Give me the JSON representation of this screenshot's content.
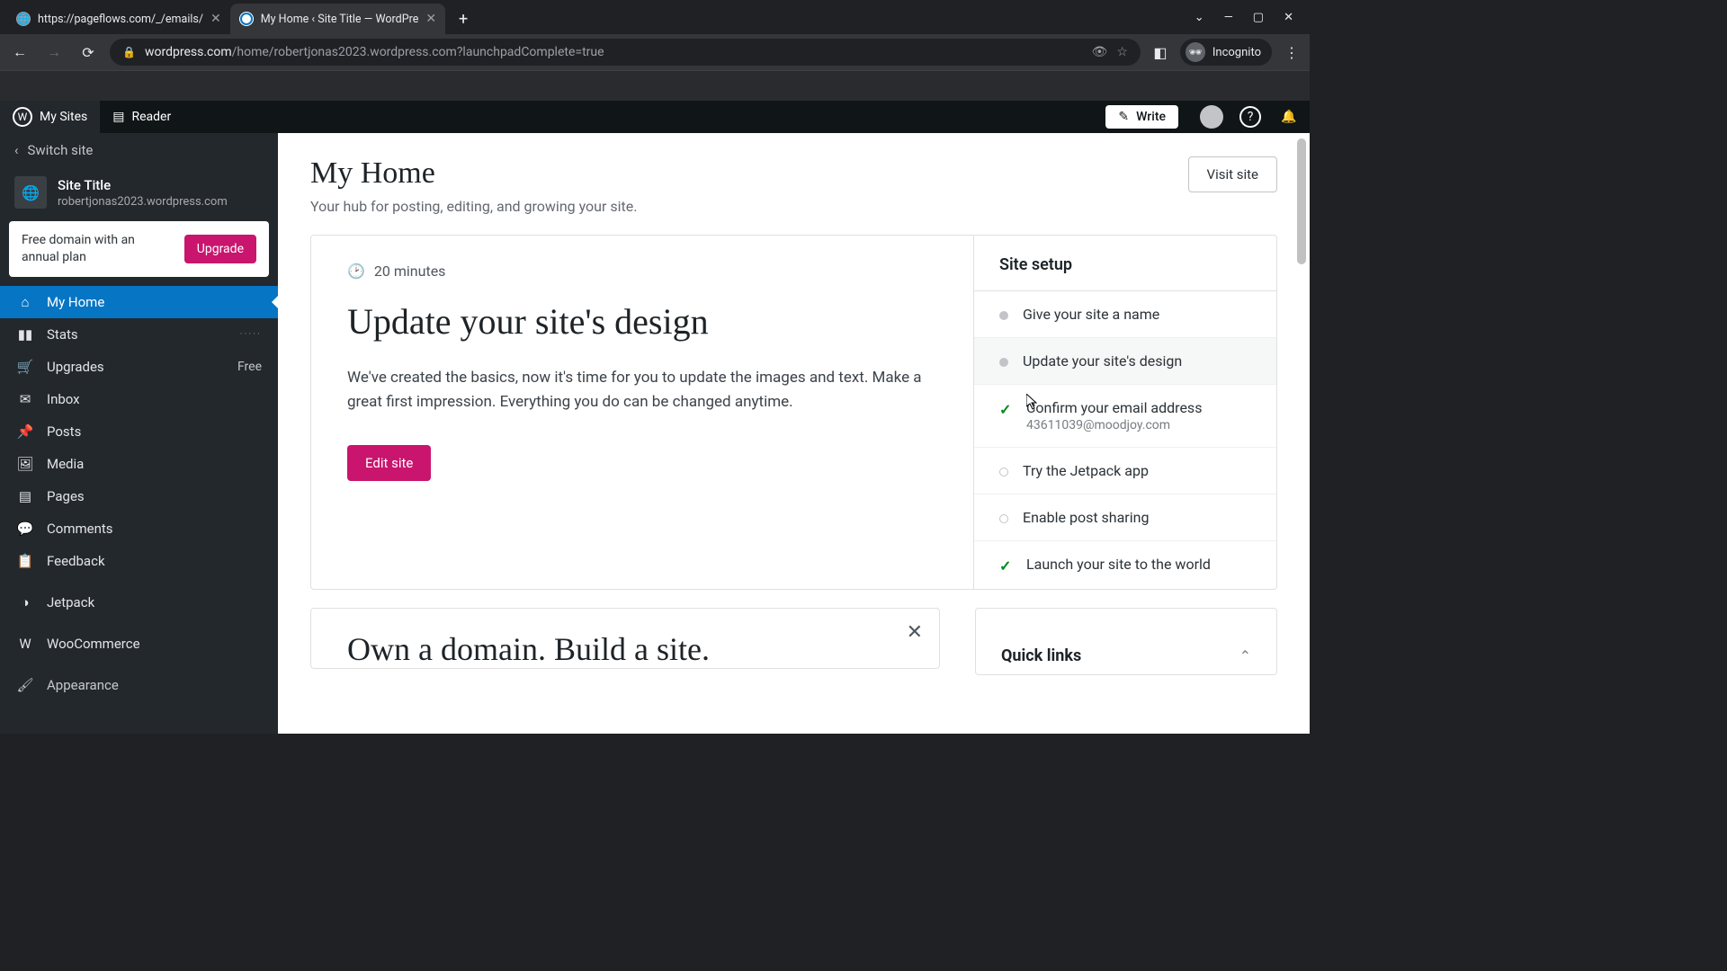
{
  "browser": {
    "tabs": [
      {
        "title": "https://pageflows.com/_/emails/",
        "active": false
      },
      {
        "title": "My Home ‹ Site Title — WordPre",
        "active": true
      }
    ],
    "url_host": "wordpress.com",
    "url_path": "/home/robertjonas2023.wordpress.com?launchpadComplete=true",
    "incognito_label": "Incognito"
  },
  "masterbar": {
    "my_sites": "My Sites",
    "reader": "Reader",
    "write": "Write"
  },
  "sidebar": {
    "switch": "Switch site",
    "site_title": "Site Title",
    "site_domain": "robertjonas2023.wordpress.com",
    "promo_text": "Free domain with an annual plan",
    "upgrade": "Upgrade",
    "items": [
      {
        "label": "My Home",
        "trail": "",
        "active": true
      },
      {
        "label": "Stats",
        "trail": "",
        "dots": true
      },
      {
        "label": "Upgrades",
        "trail": "Free"
      },
      {
        "label": "Inbox"
      },
      {
        "label": "Posts"
      },
      {
        "label": "Media"
      },
      {
        "label": "Pages"
      },
      {
        "label": "Comments"
      },
      {
        "label": "Feedback"
      },
      {
        "label": "Jetpack"
      },
      {
        "label": "WooCommerce"
      },
      {
        "label": "Appearance"
      }
    ]
  },
  "main": {
    "title": "My Home",
    "subtitle": "Your hub for posting, editing, and growing your site.",
    "visit": "Visit site",
    "card": {
      "duration": "20 minutes",
      "title": "Update your site's design",
      "desc": "We've created the basics, now it's time for you to update the images and text. Make a great first impression. Everything you do can be changed anytime.",
      "cta": "Edit site"
    },
    "setup": {
      "heading": "Site setup",
      "items": [
        {
          "label": "Give your site a name",
          "status": "dot"
        },
        {
          "label": "Update your site's design",
          "status": "dot",
          "selected": true
        },
        {
          "label": "Confirm your email address",
          "sub": "43611039@moodjoy.com",
          "status": "done"
        },
        {
          "label": "Try the Jetpack app",
          "status": "empty"
        },
        {
          "label": "Enable post sharing",
          "status": "empty"
        },
        {
          "label": "Launch your site to the world",
          "status": "done"
        }
      ]
    },
    "domain_card_title": "Own a domain. Build a site.",
    "quick_links": "Quick links"
  }
}
